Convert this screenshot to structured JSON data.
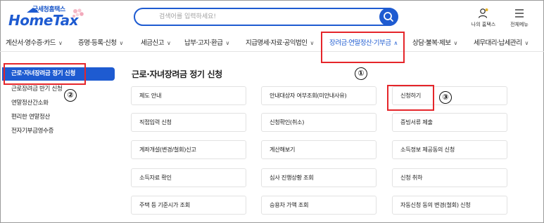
{
  "header": {
    "logo_sub": "국세청홈택스",
    "logo_main": "HomeTax",
    "search_placeholder": "검색어를 입력하세요!",
    "my_hometax_label": "나의 홈택스",
    "all_menu_label": "전체메뉴"
  },
  "nav": {
    "items": [
      {
        "label": "계산서·영수증·카드"
      },
      {
        "label": "증명·등록·신청"
      },
      {
        "label": "세금신고"
      },
      {
        "label": "납부·고지·환급"
      },
      {
        "label": "지급명세·자료·공익법인"
      },
      {
        "label": "장려금·연말정산·기부금"
      },
      {
        "label": "상담·불복·제보"
      },
      {
        "label": "세무대리·납세관리"
      }
    ],
    "active_index": 5
  },
  "sidebar": {
    "items": [
      {
        "label": "근로·자녀장려금 정기 신청"
      },
      {
        "label": "근로장려금 반기 신청"
      },
      {
        "label": "연말정산간소화"
      },
      {
        "label": "편리한 연말정산"
      },
      {
        "label": "전자기부금영수증"
      }
    ],
    "active_index": 0
  },
  "main": {
    "title": "근로·자녀장려금 정기 신청",
    "cards": [
      {
        "label": "제도 안내"
      },
      {
        "label": "안내대상자 여부조회(미안내사유)"
      },
      {
        "label": "신청하기"
      },
      {
        "label": "직접입력 신청"
      },
      {
        "label": "신청확인(취소)"
      },
      {
        "label": "증빙서류 제출"
      },
      {
        "label": "계좌개설(변경/철회)신고"
      },
      {
        "label": "계산해보기"
      },
      {
        "label": "소득정보 제공동의 신청"
      },
      {
        "label": "소득자료 확인"
      },
      {
        "label": "심사 진행상황 조회"
      },
      {
        "label": "신청 취하"
      },
      {
        "label": "주택 등 기준시가 조회"
      },
      {
        "label": "승용차 가액 조회"
      },
      {
        "label": "자동신청 동의 변경(철회) 신청"
      }
    ]
  },
  "annotations": {
    "marker_1": "①",
    "marker_2": "②",
    "marker_3": "③"
  },
  "colors": {
    "brand": "#1e5bd1",
    "annotation": "#e5252a"
  }
}
